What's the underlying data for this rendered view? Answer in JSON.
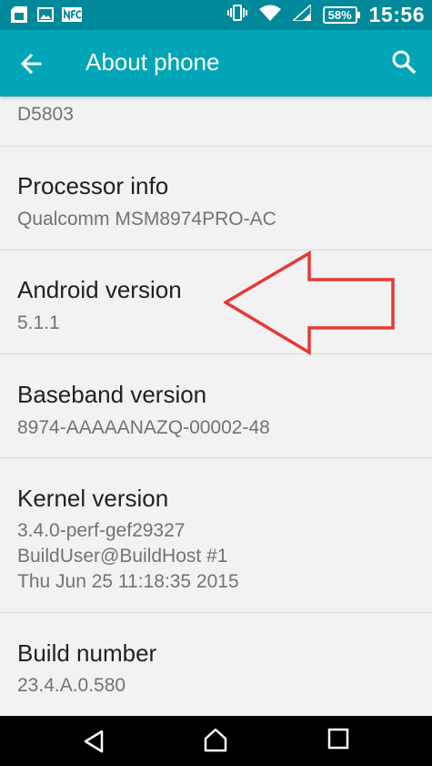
{
  "status_bar": {
    "icons": [
      "sim-card-icon",
      "image-icon",
      "nfc-icon",
      "vibrate-icon",
      "wifi-icon",
      "cellular-signal-icon"
    ],
    "battery": "58%",
    "time": "15:56",
    "color": "#00899a"
  },
  "app_bar": {
    "title": "About phone",
    "back_icon": "arrow-back-icon",
    "search_icon": "search-icon",
    "color": "#00a6b8"
  },
  "items": [
    {
      "title": "",
      "summary": "D5803"
    },
    {
      "title": "Processor info",
      "summary": "Qualcomm MSM8974PRO-AC"
    },
    {
      "title": "Android version",
      "summary": "5.1.1"
    },
    {
      "title": "Baseband version",
      "summary": "8974-AAAAANAZQ-00002-48"
    },
    {
      "title": "Kernel version",
      "summary": "3.4.0-perf-gef29327\nBuildUser@BuildHost #1\nThu Jun 25 11:18:35 2015"
    },
    {
      "title": "Build number",
      "summary": "23.4.A.0.580"
    }
  ],
  "annotation": {
    "icon": "red-arrow-annotation",
    "color": "#e53935",
    "points_to": "Android version"
  },
  "nav_bar": {
    "back_icon": "nav-back-icon",
    "home_icon": "nav-home-icon",
    "recents_icon": "nav-recents-icon"
  }
}
